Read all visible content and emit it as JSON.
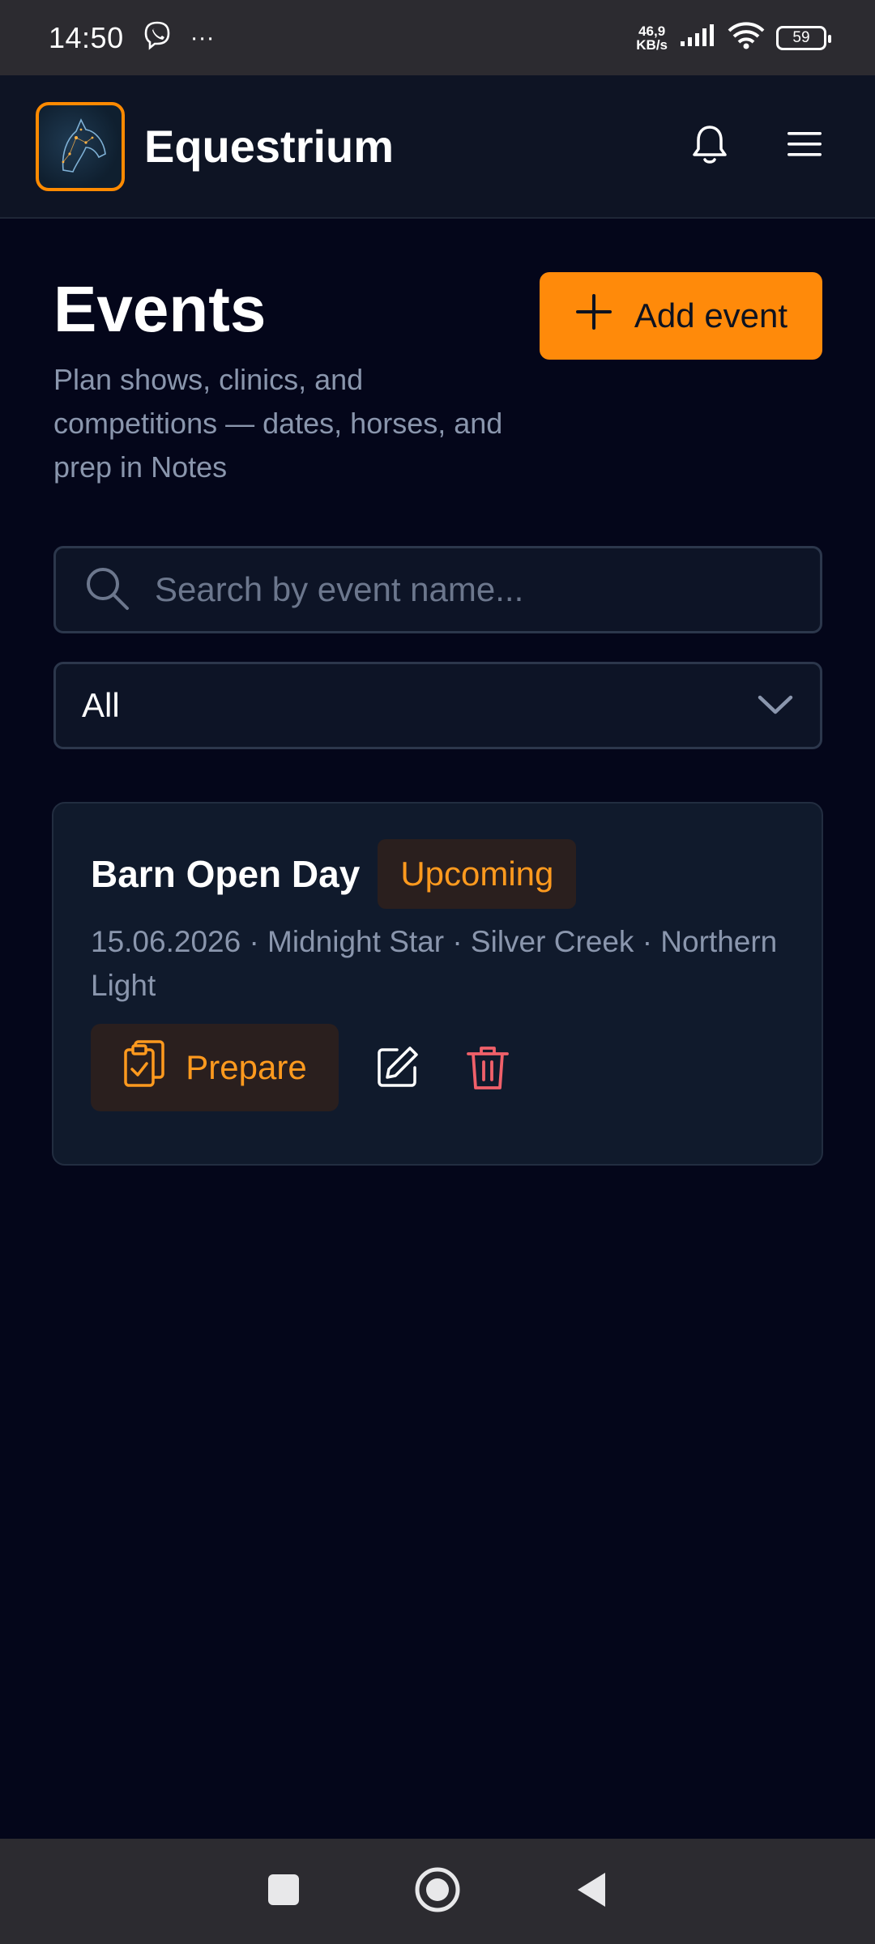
{
  "status_bar": {
    "time": "14:50",
    "more": "···",
    "speed_value": "46,9",
    "speed_unit": "KB/s",
    "battery": "59"
  },
  "header": {
    "app_name": "Equestrium",
    "accent_color": "#ff8a00"
  },
  "page": {
    "title": "Events",
    "subtitle": "Plan shows, clinics, and competitions — dates, horses, and prep in Notes",
    "add_button_label": "Add event"
  },
  "search": {
    "placeholder": "Search by event name...",
    "value": ""
  },
  "filter": {
    "selected": "All"
  },
  "events": [
    {
      "title": "Barn Open Day",
      "status": "Upcoming",
      "meta": "15.06.2026 · Midnight Star · Silver Creek · Northern Light",
      "prepare_label": "Prepare"
    }
  ],
  "icons": {
    "notifications": "bell-icon",
    "menu": "hamburger-menu-icon",
    "add": "plus-icon",
    "search": "search-icon",
    "filter": "chevron-down-icon",
    "prepare": "clipboard-check-icon",
    "edit": "pencil-icon",
    "delete": "trash-icon"
  },
  "colors": {
    "background": "#04061a",
    "primary": "#ff8a0a",
    "badge_text": "#ff9a1e",
    "delete": "#f0606a"
  }
}
